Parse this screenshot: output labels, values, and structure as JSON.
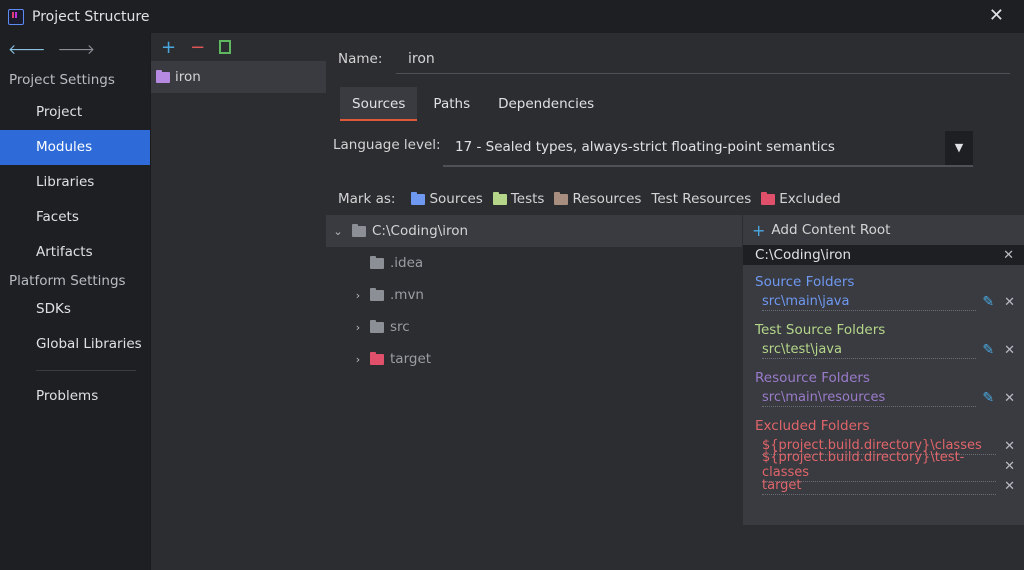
{
  "window": {
    "title": "Project Structure",
    "close_glyph": "✕"
  },
  "nav": {
    "back_glyph": "🡐",
    "forward_glyph": "🡒",
    "project_settings_label": "Project Settings",
    "project_items": [
      "Project",
      "Modules",
      "Libraries",
      "Facets",
      "Artifacts"
    ],
    "selected_item": "Modules",
    "platform_settings_label": "Platform Settings",
    "platform_items": [
      "SDKs",
      "Global Libraries"
    ],
    "problems_label": "Problems"
  },
  "modules": {
    "toolbar": {
      "add_glyph": "+",
      "remove_glyph": "−"
    },
    "items": [
      "iron"
    ]
  },
  "main": {
    "name_label": "Name:",
    "name_value": "iron",
    "tabs": [
      "Sources",
      "Paths",
      "Dependencies"
    ],
    "active_tab": "Sources",
    "language_level_label": "Language level:",
    "language_level_value": "17 - Sealed types, always-strict floating-point semantics",
    "mark_as_label": "Mark as:",
    "mark_as": [
      {
        "label": "Sources",
        "color": "#6f98f0"
      },
      {
        "label": "Tests",
        "color": "#b5d68a"
      },
      {
        "label": "Resources",
        "color": "#a88e7f"
      },
      {
        "label": "Test Resources",
        "color": ""
      },
      {
        "label": "Excluded",
        "color": "#e0506a"
      }
    ]
  },
  "tree": [
    {
      "label": "C:\\Coding\\iron",
      "expanded": true,
      "selected": true,
      "color": "#8c8f95"
    },
    {
      "label": ".idea",
      "expanded": null,
      "color": "#8c8f95"
    },
    {
      "label": ".mvn",
      "expanded": false,
      "color": "#8c8f95"
    },
    {
      "label": "src",
      "expanded": false,
      "color": "#8c8f95"
    },
    {
      "label": "target",
      "expanded": false,
      "color": "#e0506a"
    }
  ],
  "content_root": {
    "add_label": "Add Content Root",
    "root_path": "C:\\Coding\\iron",
    "source_folders": {
      "title": "Source Folders",
      "color": "#6f98f0",
      "entries": [
        "src\\main\\java"
      ]
    },
    "test_source_folders": {
      "title": "Test Source Folders",
      "color": "#b5d68a",
      "entries": [
        "src\\test\\java"
      ]
    },
    "resource_folders": {
      "title": "Resource Folders",
      "color": "#9a7bc9",
      "entries": [
        "src\\main\\resources"
      ]
    },
    "excluded_folders": {
      "title": "Excluded Folders",
      "color": "#e0656a",
      "entries": [
        "${project.build.directory}\\classes",
        "${project.build.directory}\\test-classes",
        "target"
      ]
    }
  }
}
